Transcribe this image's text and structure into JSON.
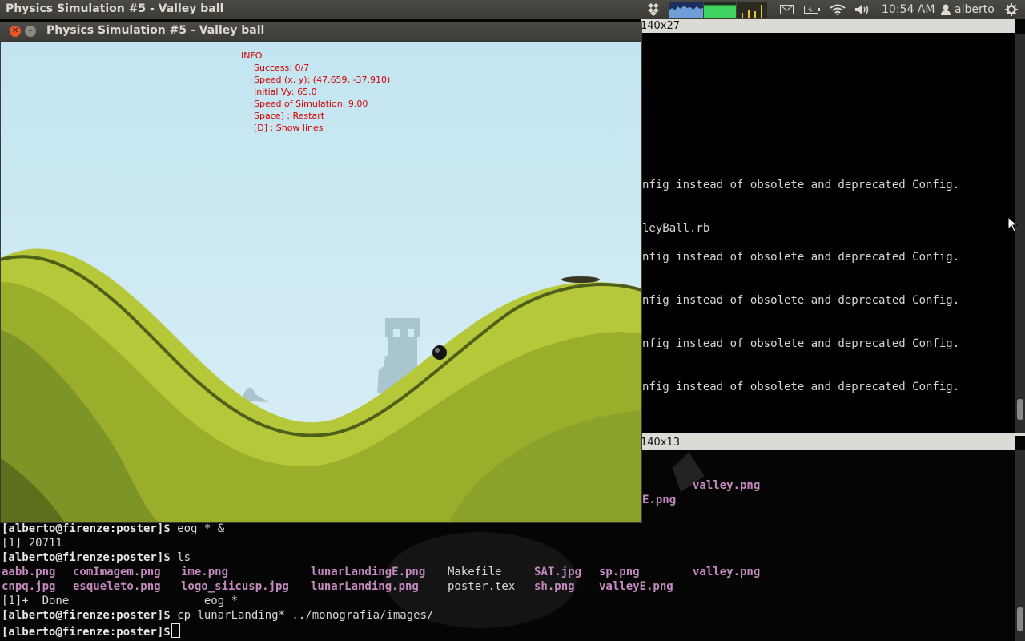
{
  "top_panel": {
    "app_title": "Physics Simulation #5 - Valley ball",
    "clock": "10:54 AM",
    "user": "alberto"
  },
  "sim_window": {
    "title": "Physics Simulation #5 - Valley ball",
    "info": {
      "heading": "INFO",
      "lines": [
        "Success: 0/7",
        "Speed (x, y): (47.659, -37.910)",
        "Initial Vy: 65.0",
        "Speed of Simulation: 9.00",
        "Space] : Restart",
        "[D] : Show lines"
      ]
    }
  },
  "term_top": {
    "title_fragment": "140x27",
    "lines": [
      "nfig instead of obsolete and deprecated Config.",
      "leyBall.rb",
      "nfig instead of obsolete and deprecated Config.",
      "nfig instead of obsolete and deprecated Config.",
      "nfig instead of obsolete and deprecated Config.",
      "nfig instead of obsolete and deprecated Config."
    ]
  },
  "term_mid": {
    "title_fragment": "140x13",
    "file1": "valley.png",
    "file2": "E.png"
  },
  "term_bottom": {
    "line1_prompt": "[alberto@firenze:poster]$",
    "line1_cmd": " eog * &",
    "line2": "[1] 20711",
    "line3_prompt": "[alberto@firenze:poster]$",
    "line3_cmd": " ls",
    "files_row1": [
      "aabb.png",
      "comImagem.png",
      "ime.png",
      "lunarLandingE.png",
      "Makefile",
      "SAT.jpg",
      "sp.png",
      "valley.png"
    ],
    "files_row2": [
      "cnpq.jpg",
      "esqueleto.png",
      "logo_siicusp.jpg",
      "lunarLanding.png",
      "poster.tex",
      "sh.png",
      "valleyE.png"
    ],
    "line6": "[1]+  Done                    eog *",
    "line7_prompt": "[alberto@firenze:poster]$",
    "line7_cmd": " cp lunarLanding* ../monografia/images/",
    "line8_prompt": "[alberto@firenze:poster]$"
  },
  "colors": {
    "panel_bg": "#3c3b37",
    "sky": "#c6e6f0",
    "info_text": "#d40000",
    "file_highlight": "#c58ac0",
    "close_button": "#e6562d"
  }
}
